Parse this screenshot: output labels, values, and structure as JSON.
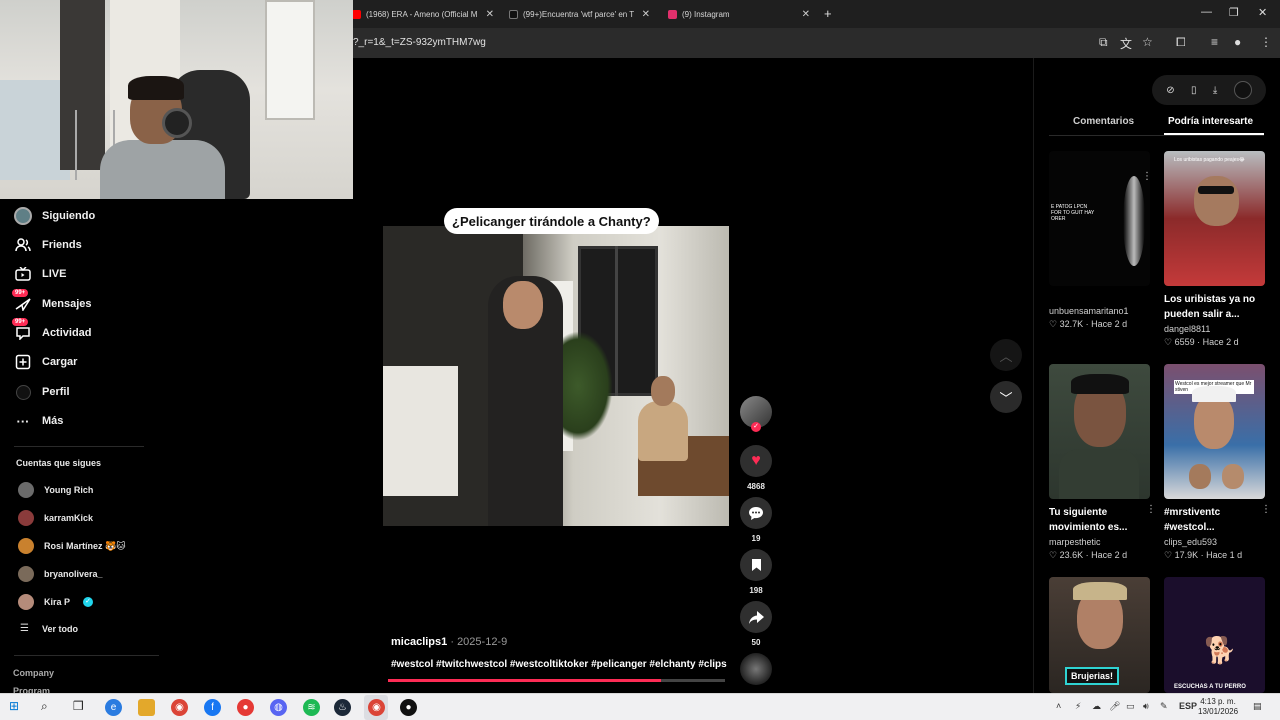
{
  "browser": {
    "tabs": [
      {
        "label": "(1968) ERA - Ameno (Official M",
        "favicon_color": "#ff0000"
      },
      {
        "label": "(99+)Encuentra 'wtf parce' en T",
        "favicon_color": "#111111"
      },
      {
        "label": "(9) Instagram",
        "favicon_color": "#e1306c"
      }
    ],
    "new_tab": "+",
    "url": "?_r=1&_t=ZS-932ymTHM7wg",
    "window_controls": [
      "—",
      "❐",
      "✕"
    ]
  },
  "sidebar": {
    "items": [
      {
        "label": "Siguiendo",
        "icon": "avatar-icon",
        "badge": ""
      },
      {
        "label": "Friends",
        "icon": "friends-icon",
        "badge": ""
      },
      {
        "label": "LIVE",
        "icon": "live-icon",
        "badge": ""
      },
      {
        "label": "Mensajes",
        "icon": "messages-icon",
        "badge": "99+"
      },
      {
        "label": "Actividad",
        "icon": "activity-icon",
        "badge": "99+"
      },
      {
        "label": "Cargar",
        "icon": "upload-icon",
        "badge": ""
      },
      {
        "label": "Perfil",
        "icon": "profile-icon",
        "badge": ""
      },
      {
        "label": "Más",
        "icon": "more-icon",
        "badge": ""
      }
    ],
    "following_title": "Cuentas que sigues",
    "following": [
      {
        "name": "Young Rich",
        "color": "#6b6b6b",
        "verified": false
      },
      {
        "name": "karramKick",
        "color": "#8a3b3b",
        "verified": false
      },
      {
        "name": "Rosi Martínez 🐯🐱",
        "color": "#c9812e",
        "verified": false
      },
      {
        "name": "bryanolivera_",
        "color": "#7a6a5a",
        "verified": false
      },
      {
        "name": "Kira P",
        "color": "#b58b7a",
        "verified": true
      }
    ],
    "see_all": "Ver todo",
    "footer": [
      "Company",
      "Program"
    ]
  },
  "video": {
    "title": "¿Pelicanger tirándole a Chanty?",
    "author": "micaclips1",
    "separator": "·",
    "date": "2025-12-9",
    "hashtags": "#westcol #twitchwestcol #westcoltiktoker #pelicanger #elchanty #clips",
    "progress": 0.81
  },
  "actions": {
    "likes": "4868",
    "comments": "19",
    "saves": "198",
    "shares": "50"
  },
  "right_panel": {
    "pill_icons": [
      "compass-icon",
      "phone-icon",
      "download-icon",
      "avatar-icon"
    ],
    "tabs": [
      "Comentarios",
      "Podría interesarte"
    ],
    "active_tab": 1,
    "cards": [
      {
        "title": "",
        "user": "unbuensamaritano1",
        "likes": "32.7K",
        "age": "Hace 2 d",
        "thumb_text": "E PATOG LPCN FOR TO GUIT HAY ORER"
      },
      {
        "title": "Los uribistas ya no pueden salir a...",
        "user": "dangel8811",
        "likes": "6559",
        "age": "Hace 2 d",
        "thumb_text": "Los uribistas pagando peajes😂"
      },
      {
        "title": "Tu siguiente movimiento es...",
        "user": "marpesthetic",
        "likes": "23.6K",
        "age": "Hace 2 d",
        "thumb_text": ""
      },
      {
        "title": "#mrstiventc #westcol...",
        "user": "clips_edu593",
        "likes": "17.9K",
        "age": "Hace 1 d",
        "thumb_text": "Westcol es mejor streamer que Mr stiven"
      },
      {
        "title": "",
        "user": "",
        "likes": "",
        "age": "",
        "thumb_text": "Brujerias!"
      },
      {
        "title": "",
        "user": "",
        "likes": "",
        "age": "",
        "thumb_text": "ESCUCHAS A TU PERRO"
      }
    ]
  },
  "taskbar": {
    "language": "ESP",
    "time": "4:13 p. m.",
    "date": "13/01/2026"
  },
  "colors": {
    "accent": "#fe2c55",
    "background": "#000000",
    "taskbar": "#f0f0f2"
  }
}
